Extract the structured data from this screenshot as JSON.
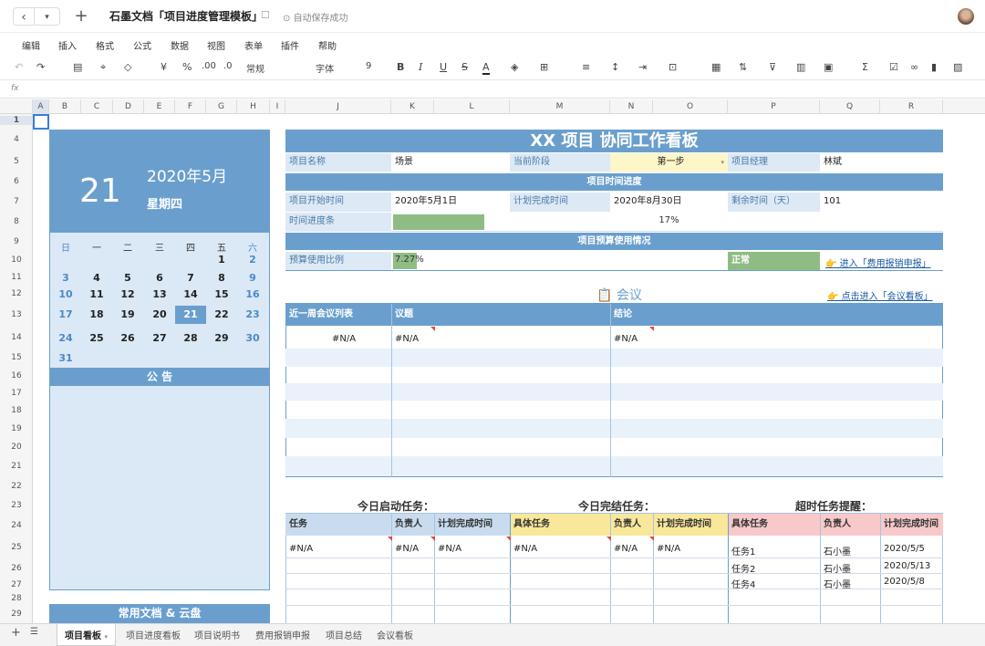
{
  "titlebar": {
    "back_icon": "‹",
    "dropdown_icon": "▾",
    "add_icon": "+",
    "doc_title": "石墨文档「项目进度管理模板」",
    "save_status": "自动保存成功"
  },
  "menu": [
    "编辑",
    "插入",
    "格式",
    "公式",
    "数据",
    "视图",
    "表单",
    "插件",
    "帮助"
  ],
  "toolbar": {
    "currency": "¥",
    "percent": "%",
    "dec_inc": ".00",
    "dec_dec": ".0",
    "number_format": "常规",
    "font": "字体",
    "font_size": "9",
    "bold": "B",
    "italic": "I",
    "underline": "U",
    "strike": "S",
    "font_color": "A",
    "sum": "Σ"
  },
  "formula_bar": {
    "fx": "fx"
  },
  "columns": [
    "A",
    "B",
    "C",
    "D",
    "E",
    "F",
    "G",
    "H",
    "I",
    "J",
    "K",
    "L",
    "M",
    "N",
    "O",
    "P",
    "Q",
    "R"
  ],
  "rows": [
    "1",
    "4",
    "5",
    "6",
    "7",
    "8",
    "9",
    "10",
    "11",
    "12",
    "13",
    "14",
    "15",
    "16",
    "17",
    "18",
    "19",
    "20",
    "21",
    "22",
    "23",
    "24",
    "25",
    "26",
    "27",
    "28",
    "29"
  ],
  "calendar": {
    "day": "21",
    "month": "2020年5月",
    "weekday": "星期四",
    "weekdays": [
      "日",
      "一",
      "二",
      "三",
      "四",
      "五",
      "六"
    ],
    "weeks": [
      [
        "",
        "",
        "",
        "",
        "",
        "1",
        "2"
      ],
      [
        "3",
        "4",
        "5",
        "6",
        "7",
        "8",
        "9"
      ],
      [
        "10",
        "11",
        "12",
        "13",
        "14",
        "15",
        "16"
      ],
      [
        "17",
        "18",
        "19",
        "20",
        "21",
        "22",
        "23"
      ],
      [
        "24",
        "25",
        "26",
        "27",
        "28",
        "29",
        "30"
      ],
      [
        "31",
        "",
        "",
        "",
        "",
        "",
        ""
      ]
    ],
    "notice": "公 告",
    "docs": "常用文档 & 云盘"
  },
  "board": {
    "title": "XX 项目 协同工作看板",
    "project_name_label": "项目名称",
    "project_name": "场景",
    "stage_label": "当前阶段",
    "stage": "第一步",
    "manager_label": "项目经理",
    "manager": "林斌",
    "time_section": "项目时间进度",
    "start_label": "项目开始时间",
    "start": "2020年5月1日",
    "plan_end_label": "计划完成时间",
    "plan_end": "2020年8月30日",
    "remaining_label": "剩余时间（天）",
    "remaining": "101",
    "progress_label": "时间进度条",
    "progress_value": 0.17,
    "progress_text": "17%",
    "budget_section": "项目预算使用情况",
    "budget_label": "预算使用比例",
    "budget_value": 0.0727,
    "budget_text": "7.27%",
    "budget_status": "正常",
    "expense_link": "👉 进入「费用报销申报」",
    "meeting_title": "📋 会议",
    "meeting_link": "👉 点击进入「会议看板」",
    "meeting_headers": [
      "近一周会议列表",
      "议题",
      "结论"
    ],
    "meeting_row": [
      "#N/A",
      "#N/A",
      "#N/A"
    ],
    "today_start_title": "今日启动任务：",
    "today_done_title": "今日完结任务：",
    "overdue_title": "超时任务提醒：",
    "start_headers": [
      "任务",
      "负责人",
      "计划完成时间"
    ],
    "done_headers": [
      "具体任务",
      "负责人",
      "计划完成时间"
    ],
    "overdue_headers": [
      "具体任务",
      "负责人",
      "计划完成时间"
    ],
    "start_row": [
      "#N/A",
      "#N/A",
      "#N/A"
    ],
    "done_row": [
      "#N/A",
      "#N/A",
      "#N/A"
    ],
    "overdue_rows": [
      [
        "任务1",
        "石小墨",
        "2020/5/5"
      ],
      [
        "任务2",
        "石小墨",
        "2020/5/13"
      ],
      [
        "任务4",
        "石小墨",
        "2020/5/8"
      ]
    ]
  },
  "tabs": [
    "项目看板",
    "项目进度看板",
    "项目说明书",
    "费用报销申报",
    "项目总结",
    "会议看板"
  ],
  "colors": {
    "accent": "#6a9fcd",
    "progress": "#8fbc85",
    "stage_bg": "#fdf6c8",
    "done_header": "#f9e79a",
    "overdue_header": "#f7c9c9"
  }
}
